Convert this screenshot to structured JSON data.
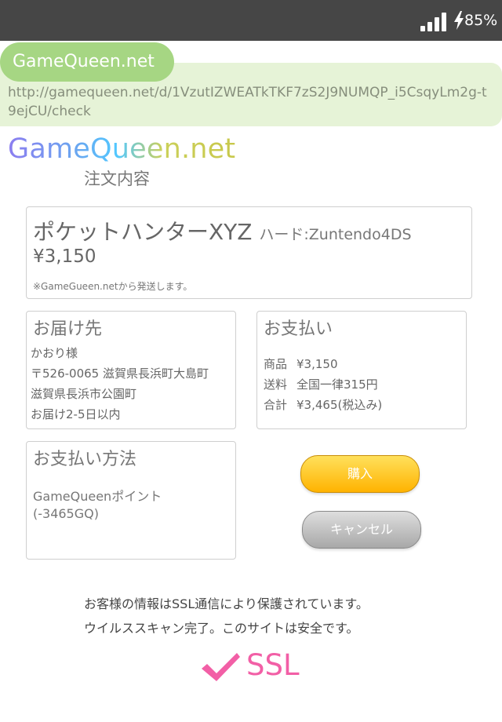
{
  "status_bar": {
    "battery": "85%",
    "signal_icon": "signal-bars-icon",
    "charging_icon": "lightning-bolt-icon"
  },
  "browser": {
    "site_label": "GameQueen.net",
    "url": "http://gamequeen.net/d/1VzutIZWEATkTKF7zS2J9NUMQP_i5CsqyLm2g-t9ejCU/check"
  },
  "header": {
    "logo": "GameQueen.net",
    "title": "注文内容"
  },
  "product": {
    "name": "ポケットハンターXYZ",
    "hardware": "ハード:Zuntendo4DS",
    "price": "¥3,150",
    "note": "※GameGueen.netから発送します。"
  },
  "shipping": {
    "heading": "お届け先",
    "lines": [
      "かおり様",
      "〒526-0065 滋賀県長浜町大島町",
      "滋賀県長浜市公園町",
      "お届け2-5日以内"
    ]
  },
  "payment": {
    "heading": "お支払い",
    "rows": [
      {
        "label": "商品",
        "value": "¥3,150"
      },
      {
        "label": "送料",
        "value": "全国一律315円"
      },
      {
        "label": "合計",
        "value": "¥3,465(税込み)"
      }
    ]
  },
  "payment_method": {
    "heading": "お支払い方法",
    "lines": [
      "GameQueenポイント",
      "(-3465GQ)"
    ]
  },
  "actions": {
    "buy_label": "購入",
    "cancel_label": "キャンセル",
    "buy_color": "#ffc21f",
    "cancel_color": "#c4c4c4"
  },
  "security": {
    "line1": "お客様の情報はSSL通信により保護されています。",
    "line2": "ウイルススキャン完了。このサイトは安全です。",
    "badge": "SSL",
    "badge_icon": "checkmark-icon",
    "badge_color": "#f25fa6"
  }
}
